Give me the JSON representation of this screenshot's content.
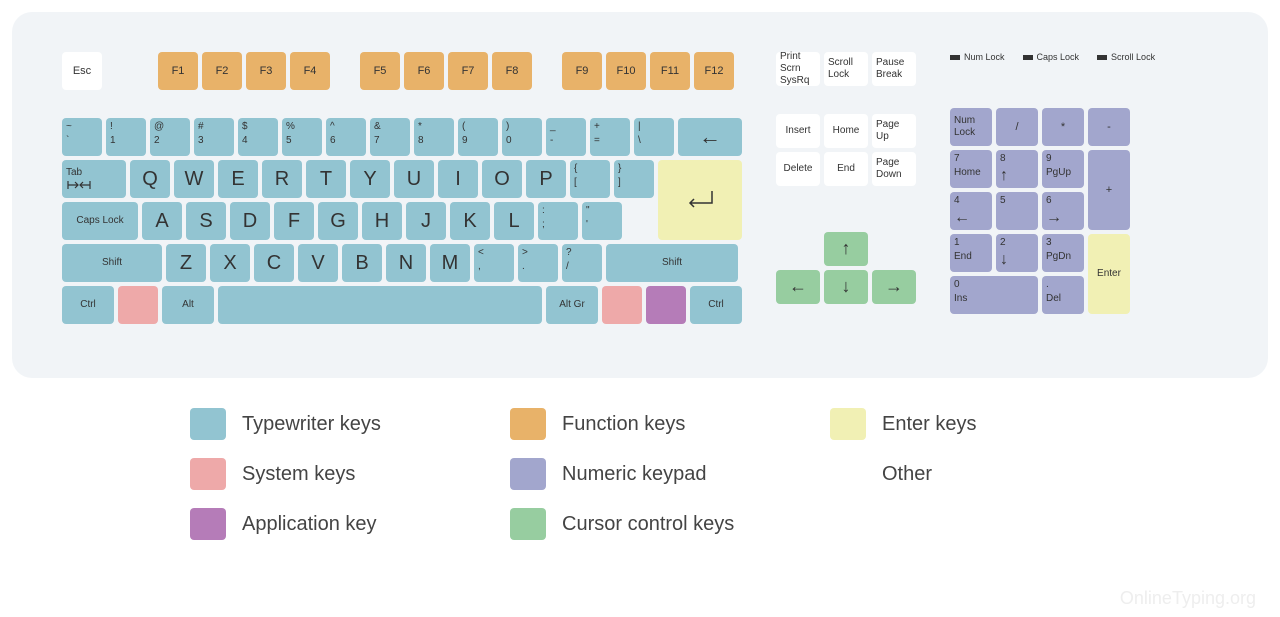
{
  "colors": {
    "typewriter": "#92c4d1",
    "function": "#e8b269",
    "enter": "#f1f0b4",
    "system": "#eea9a9",
    "numeric": "#a2a6cd",
    "application": "#b57cb8",
    "cursor": "#97cda0",
    "other": "#ffffff"
  },
  "esc": "Esc",
  "fkeys": [
    "F1",
    "F2",
    "F3",
    "F4",
    "F5",
    "F6",
    "F7",
    "F8",
    "F9",
    "F10",
    "F11",
    "F12"
  ],
  "row1": [
    {
      "t": "~",
      "b": "`"
    },
    {
      "t": "!",
      "b": "1"
    },
    {
      "t": "@",
      "b": "2"
    },
    {
      "t": "#",
      "b": "3"
    },
    {
      "t": "$",
      "b": "4"
    },
    {
      "t": "%",
      "b": "5"
    },
    {
      "t": "^",
      "b": "6"
    },
    {
      "t": "&",
      "b": "7"
    },
    {
      "t": "*",
      "b": "8"
    },
    {
      "t": "(",
      "b": "9"
    },
    {
      "t": ")",
      "b": "0"
    },
    {
      "t": "_",
      "b": "-"
    },
    {
      "t": "+",
      "b": "="
    },
    {
      "t": "|",
      "b": "\\"
    }
  ],
  "backspace": "←",
  "tab": "Tab",
  "row2": [
    "Q",
    "W",
    "E",
    "R",
    "T",
    "Y",
    "U",
    "I",
    "O",
    "P"
  ],
  "row2end": [
    {
      "t": "{",
      "b": "["
    },
    {
      "t": "}",
      "b": "]"
    }
  ],
  "caps": "Caps Lock",
  "row3": [
    "A",
    "S",
    "D",
    "F",
    "G",
    "H",
    "J",
    "K",
    "L"
  ],
  "row3end": [
    {
      "t": ":",
      "b": ";"
    },
    {
      "t": "\"",
      "b": "'"
    }
  ],
  "shift_l": "Shift",
  "row4": [
    "Z",
    "X",
    "C",
    "V",
    "B",
    "N",
    "M"
  ],
  "row4end": [
    {
      "t": "<",
      "b": ","
    },
    {
      "t": ">",
      "b": "."
    },
    {
      "t": "?",
      "b": "/"
    }
  ],
  "shift_r": "Shift",
  "ctrl_l": "Ctrl",
  "alt_l": "Alt",
  "altgr": "Alt Gr",
  "ctrl_r": "Ctrl",
  "nav": {
    "r1": [
      "Print Scrn SysRq",
      "Scroll Lock",
      "Pause Break"
    ],
    "r2": [
      "Insert",
      "Home",
      "Page Up"
    ],
    "r3": [
      "Delete",
      "End",
      "Page Down"
    ]
  },
  "locks": [
    "Num Lock",
    "Caps Lock",
    "Scroll Lock"
  ],
  "numpad": {
    "r1": [
      "Num Lock",
      "/",
      "*",
      "-"
    ],
    "r2": [
      {
        "t": "7",
        "b": "Home"
      },
      {
        "t": "8",
        "b": "↑"
      },
      {
        "t": "9",
        "b": "PgUp"
      }
    ],
    "plus": "+",
    "r3": [
      {
        "t": "4",
        "b": "←"
      },
      {
        "t": "5",
        "b": ""
      },
      {
        "t": "6",
        "b": "→"
      }
    ],
    "r4": [
      {
        "t": "1",
        "b": "End"
      },
      {
        "t": "2",
        "b": "↓"
      },
      {
        "t": "3",
        "b": "PgDn"
      }
    ],
    "enter": "Enter",
    "r5": [
      {
        "t": "0",
        "b": "Ins"
      },
      {
        "t": ".",
        "b": "Del"
      }
    ]
  },
  "legend": [
    {
      "c": "typewriter",
      "l": "Typewriter keys"
    },
    {
      "c": "function",
      "l": "Function keys"
    },
    {
      "c": "enter",
      "l": "Enter keys"
    },
    {
      "c": "system",
      "l": "System keys"
    },
    {
      "c": "numeric",
      "l": "Numeric keypad"
    },
    {
      "c": "other",
      "l": "Other"
    },
    {
      "c": "application",
      "l": "Application key"
    },
    {
      "c": "cursor",
      "l": "Cursor control keys"
    }
  ],
  "watermark": "OnlineTyping.org"
}
